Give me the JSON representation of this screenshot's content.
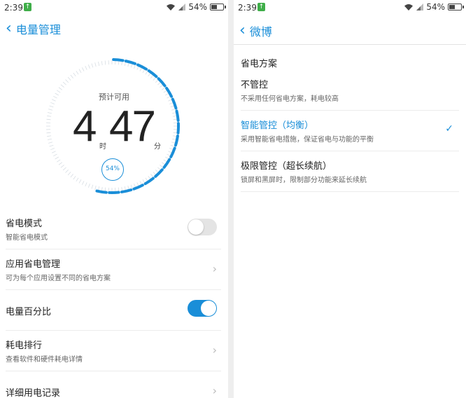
{
  "left": {
    "status": {
      "time": "2:39",
      "battery_text": "54%",
      "battery_level": 0.54
    },
    "nav": {
      "back_label": "电量管理"
    },
    "gauge": {
      "label": "预计可用",
      "hours": "4",
      "hours_unit": "时",
      "minutes": "47",
      "minutes_unit": "分",
      "percent_text": "54%",
      "percent_value": 0.54,
      "accent": "#1a8ed8"
    },
    "settings": [
      {
        "title": "省电模式",
        "subtitle": "智能省电模式",
        "control": "toggle",
        "on": false
      },
      {
        "title": "应用省电管理",
        "subtitle": "可为每个应用设置不同的省电方案",
        "control": "arrow"
      },
      {
        "title": "电量百分比",
        "subtitle": "",
        "control": "toggle",
        "on": true
      },
      {
        "title": "耗电排行",
        "subtitle": "查看软件和硬件耗电详情",
        "control": "arrow"
      },
      {
        "title": "详细用电记录",
        "subtitle": "",
        "control": "arrow"
      }
    ]
  },
  "right": {
    "status": {
      "time": "2:39",
      "battery_text": "54%",
      "battery_level": 0.54
    },
    "nav": {
      "back_label": "微博"
    },
    "section_title": "省电方案",
    "options": [
      {
        "title": "不管控",
        "subtitle": "不采用任何省电方案，耗电较高",
        "selected": false
      },
      {
        "title": "智能管控（均衡）",
        "subtitle": "采用智能省电措施，保证省电与功能的平衡",
        "selected": true
      },
      {
        "title": "极限管控（超长续航）",
        "subtitle": "锁屏和黑屏时，限制部分功能来延长续航",
        "selected": false
      }
    ]
  },
  "icons": {
    "back": "chevron-left-icon",
    "wifi": "wifi-icon",
    "signal": "signal-icon",
    "battery": "battery-icon",
    "arrow": "chevron-right-icon",
    "check": "checkmark-icon",
    "notification": "notification-icon"
  }
}
